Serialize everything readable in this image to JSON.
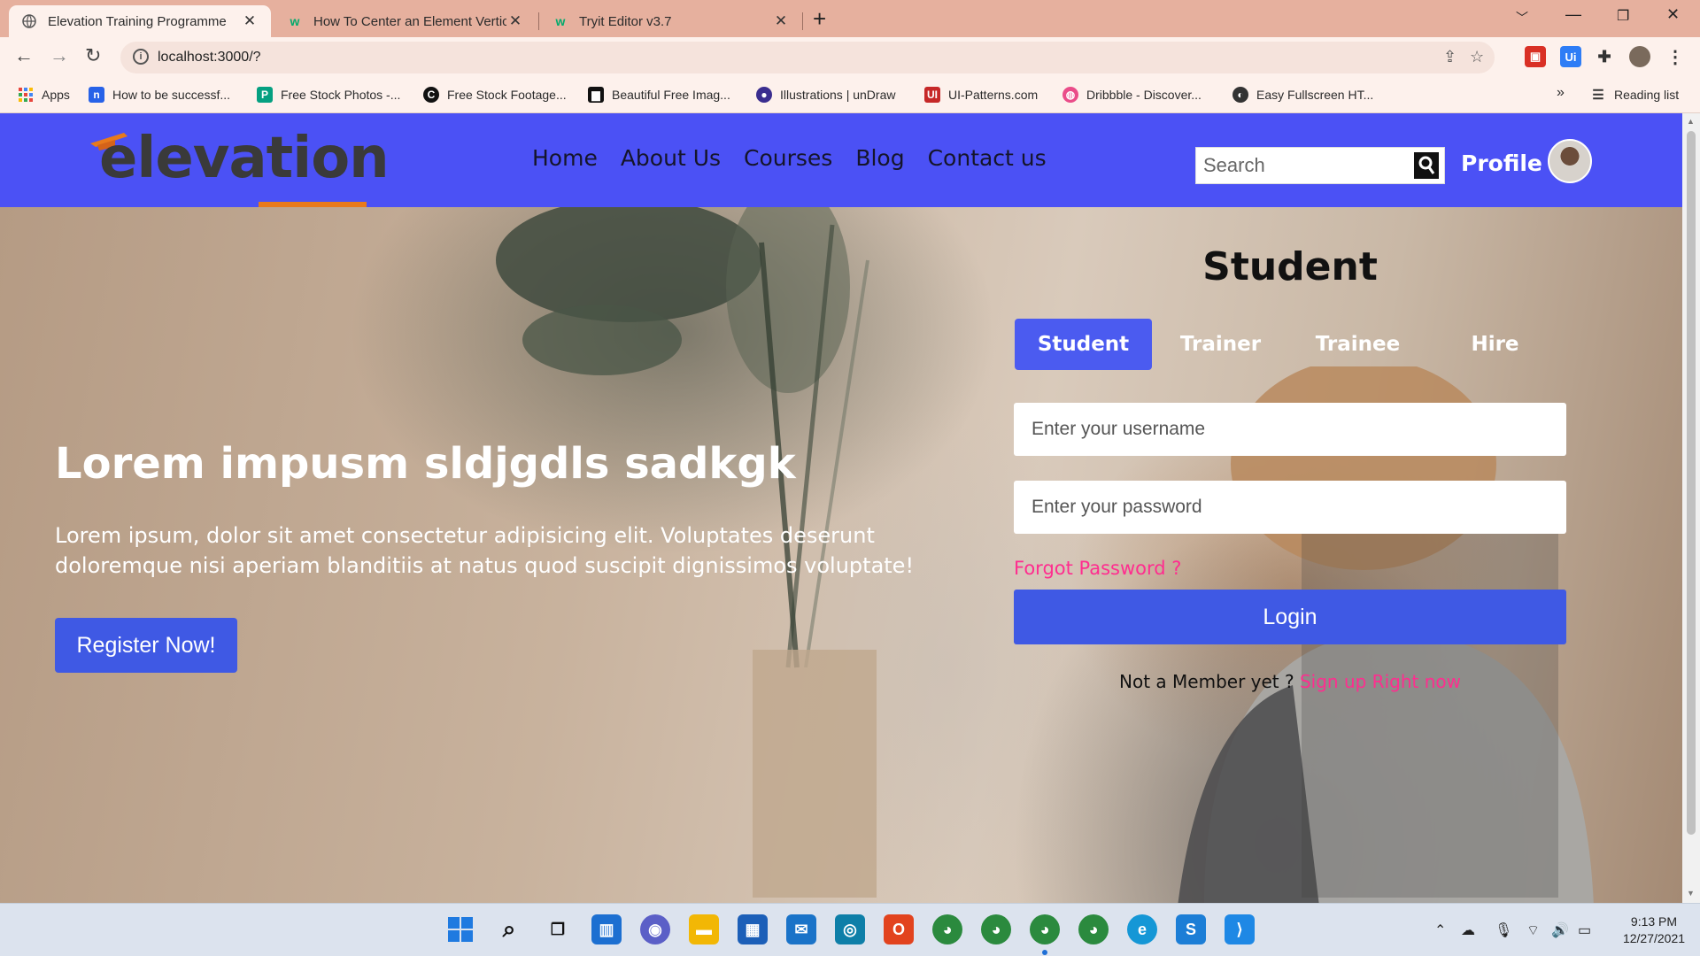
{
  "browser": {
    "tabs": [
      {
        "title": "Elevation Training Programme",
        "active": true
      },
      {
        "title": "How To Center an Element Vertic",
        "active": false
      },
      {
        "title": "Tryit Editor v3.7",
        "active": false
      }
    ],
    "url": "localhost:3000/?",
    "bookmarks": [
      {
        "label": "Apps",
        "icon": "apps-grid-icon"
      },
      {
        "label": "How to be successf...",
        "icon": "notion-icon"
      },
      {
        "label": "Free Stock Photos -...",
        "icon": "pexels-icon"
      },
      {
        "label": "Free Stock Footage...",
        "icon": "footage-icon"
      },
      {
        "label": "Beautiful Free Imag...",
        "icon": "unsplash-icon"
      },
      {
        "label": "Illustrations | unDraw",
        "icon": "undraw-icon"
      },
      {
        "label": "UI-Patterns.com",
        "icon": "ui-patterns-icon"
      },
      {
        "label": "Dribbble - Discover...",
        "icon": "dribbble-icon"
      },
      {
        "label": "Easy Fullscreen HT...",
        "icon": "globe-icon"
      }
    ],
    "reading_list": "Reading list",
    "more_bookmarks": "»"
  },
  "site": {
    "logo": "elevation",
    "nav": [
      "Home",
      "About Us",
      "Courses",
      "Blog",
      "Contact us"
    ],
    "search_placeholder": "Search",
    "profile_label": "Profile"
  },
  "hero": {
    "title": "Lorem impusm sldjgdls sadkgk",
    "text": "Lorem ipsum, dolor sit amet consectetur adipisicing elit. Voluptates deserunt doloremque nisi aperiam blanditiis at natus quod suscipit dignissimos voluptate!",
    "cta": "Register Now!"
  },
  "login": {
    "title": "Student",
    "tabs": [
      "Student",
      "Trainer",
      "Trainee",
      "Hire"
    ],
    "active_tab": "Student",
    "username_placeholder": "Enter your username",
    "password_placeholder": "Enter your password",
    "forgot": "Forgot Password ?",
    "button": "Login",
    "signup_prompt": "Not a Member yet ?",
    "signup_link": "Sign up Right now"
  },
  "taskbar": {
    "time": "9:13 PM",
    "date": "12/27/2021"
  },
  "colors": {
    "nav_bg": "#4b51f5",
    "primary_button": "#3f59e4",
    "link_pink": "#ff2d8f",
    "logo_accent": "#e87a1c",
    "tabbar": "#e6b09e"
  }
}
